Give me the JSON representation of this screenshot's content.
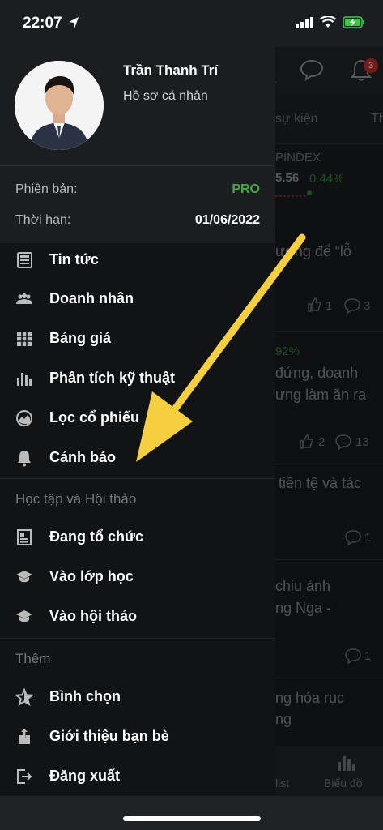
{
  "status_bar": {
    "time": "22:07"
  },
  "profile": {
    "name": "Trần Thanh Trí",
    "profile_link": "Hồ sơ cá nhân"
  },
  "subscription": {
    "version_label": "Phiên bản:",
    "version_value": "PRO",
    "expiry_label": "Thời hạn:",
    "expiry_value": "01/06/2022"
  },
  "menu": {
    "main_items": [
      {
        "label": "Tin tức",
        "icon": "news-icon"
      },
      {
        "label": "Doanh nhân",
        "icon": "people-icon"
      },
      {
        "label": "Bảng giá",
        "icon": "grid-icon"
      },
      {
        "label": "Phân tích kỹ thuật",
        "icon": "bar-chart-icon"
      },
      {
        "label": "Lọc cổ phiếu",
        "icon": "filter-chart-icon"
      },
      {
        "label": "Cảnh báo",
        "icon": "bell-icon"
      }
    ],
    "learning_title": "Học tập và Hội thảo",
    "learning_items": [
      {
        "label": "Đang tổ chức",
        "icon": "document-icon"
      },
      {
        "label": "Vào lớp học",
        "icon": "graduation-cap-icon"
      },
      {
        "label": "Vào hội thảo",
        "icon": "graduation-cap-icon"
      }
    ],
    "more_title": "Thêm",
    "more_items": [
      {
        "label": "Bình chọn",
        "icon": "star-icon"
      },
      {
        "label": "Giới thiệu bạn bè",
        "icon": "share-icon"
      },
      {
        "label": "Đăng xuất",
        "icon": "logout-icon"
      }
    ]
  },
  "background": {
    "notification_count": "3",
    "tab_events": "sự kiện",
    "tab_partial": "Th",
    "index_name": "PINDEX",
    "index_value": "5.56",
    "index_change": "0.44%",
    "news": [
      {
        "line1": "ương để “lỗ",
        "line2": "",
        "likes": "1",
        "comments": "3"
      },
      {
        "change": "92%",
        "line1": "đứng, doanh",
        "line2": "ưng làm ăn ra",
        "likes": "2",
        "comments": "13"
      },
      {
        "line1": "tiền tệ và tác",
        "line2": "",
        "comments": "1"
      },
      {
        "line1": "chịu ảnh",
        "line2": "ng Nga -",
        "comments": "1"
      },
      {
        "line1": "ng hóa rục",
        "line2": "ng"
      }
    ],
    "nav_watchlist": "list",
    "nav_chart": "Biểu đồ"
  },
  "colors": {
    "accent_green": "#3daf3d",
    "arrow_yellow": "#f5cf3f",
    "badge_red": "#d9302c"
  }
}
